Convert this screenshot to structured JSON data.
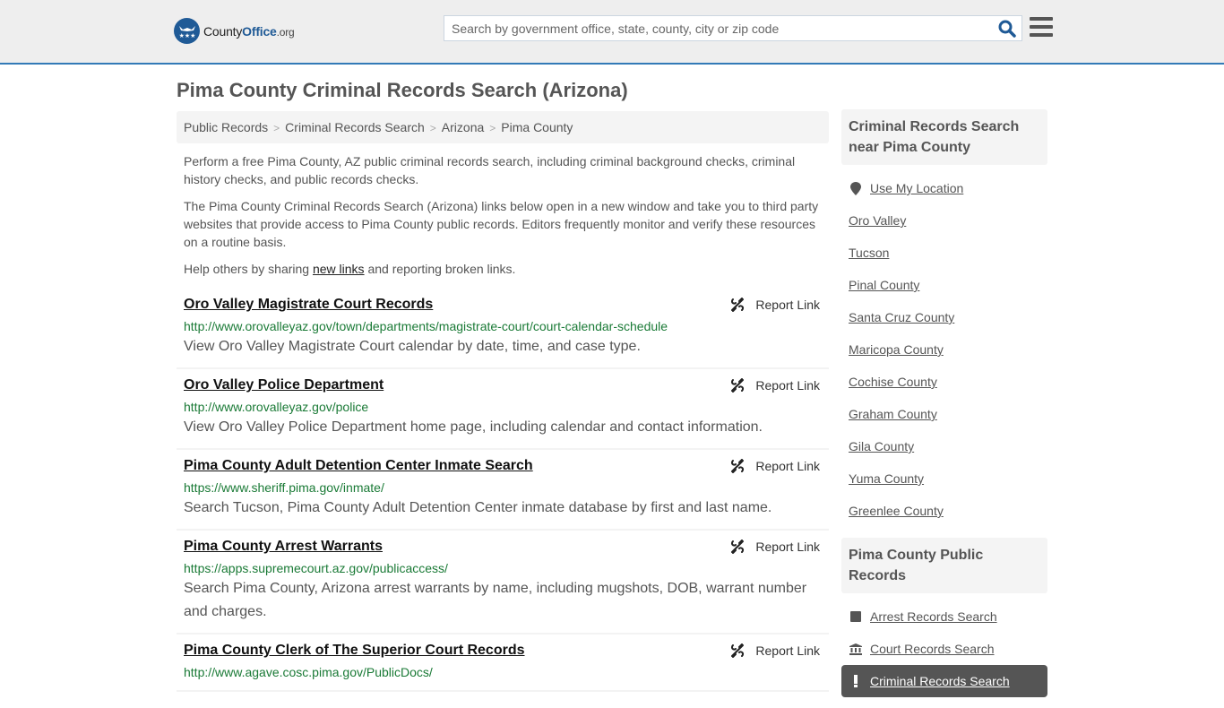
{
  "header": {
    "logo": {
      "brand_part1": "County",
      "brand_part2": "Office",
      "brand_tld": ".org"
    },
    "search": {
      "placeholder": "Search by government office, state, county, city or zip code",
      "value": ""
    },
    "icons": {
      "search": "search-icon",
      "menu": "hamburger-menu-icon"
    }
  },
  "page": {
    "title": "Pima County Criminal Records Search (Arizona)",
    "breadcrumb": [
      {
        "label": "Public Records"
      },
      {
        "label": "Criminal Records Search"
      },
      {
        "label": "Arizona"
      },
      {
        "label": "Pima County"
      }
    ],
    "breadcrumb_separator": ">",
    "intro": {
      "p1": "Perform a free Pima County, AZ public criminal records search, including criminal background checks, criminal history checks, and public records checks.",
      "p2": "The Pima County Criminal Records Search (Arizona) links below open in a new window and take you to third party websites that provide access to Pima County public records. Editors frequently monitor and verify these resources on a routine basis.",
      "p3_before": "Help others by sharing ",
      "p3_link": "new links",
      "p3_after": " and reporting broken links."
    }
  },
  "results": [
    {
      "title": "Oro Valley Magistrate Court Records",
      "url": "http://www.orovalleyaz.gov/town/departments/magistrate-court/court-calendar-schedule",
      "description": "View Oro Valley Magistrate Court calendar by date, time, and case type.",
      "report_label": "Report Link"
    },
    {
      "title": "Oro Valley Police Department",
      "url": "http://www.orovalleyaz.gov/police",
      "description": "View Oro Valley Police Department home page, including calendar and contact information.",
      "report_label": "Report Link"
    },
    {
      "title": "Pima County Adult Detention Center Inmate Search",
      "url": "https://www.sheriff.pima.gov/inmate/",
      "description": "Search Tucson, Pima County Adult Detention Center inmate database by first and last name.",
      "report_label": "Report Link"
    },
    {
      "title": "Pima County Arrest Warrants",
      "url": "https://apps.supremecourt.az.gov/publicaccess/",
      "description": "Search Pima County, Arizona arrest warrants by name, including mugshots, DOB, warrant number and charges.",
      "report_label": "Report Link"
    },
    {
      "title": "Pima County Clerk of The Superior Court Records",
      "url": "http://www.agave.cosc.pima.gov/PublicDocs/",
      "description": "",
      "report_label": "Report Link"
    }
  ],
  "sidebar": {
    "nearby": {
      "heading": "Criminal Records Search near Pima County",
      "use_location": "Use My Location",
      "items": [
        "Oro Valley",
        "Tucson",
        "Pinal County",
        "Santa Cruz County",
        "Maricopa County",
        "Cochise County",
        "Graham County",
        "Gila County",
        "Yuma County",
        "Greenlee County"
      ]
    },
    "public_records": {
      "heading": "Pima County Public Records",
      "items": [
        {
          "label": "Arrest Records Search",
          "icon": "square-icon",
          "active": false
        },
        {
          "label": "Court Records Search",
          "icon": "courthouse-icon",
          "active": false
        },
        {
          "label": "Criminal Records Search",
          "icon": "exclamation-icon",
          "active": true
        }
      ]
    }
  },
  "colors": {
    "header_bg": "#eeeeee",
    "header_border": "#337ab7",
    "brand_blue": "#1f5a96",
    "url_green": "#1a7a36",
    "text": "#555555",
    "active_bg": "#555555"
  }
}
